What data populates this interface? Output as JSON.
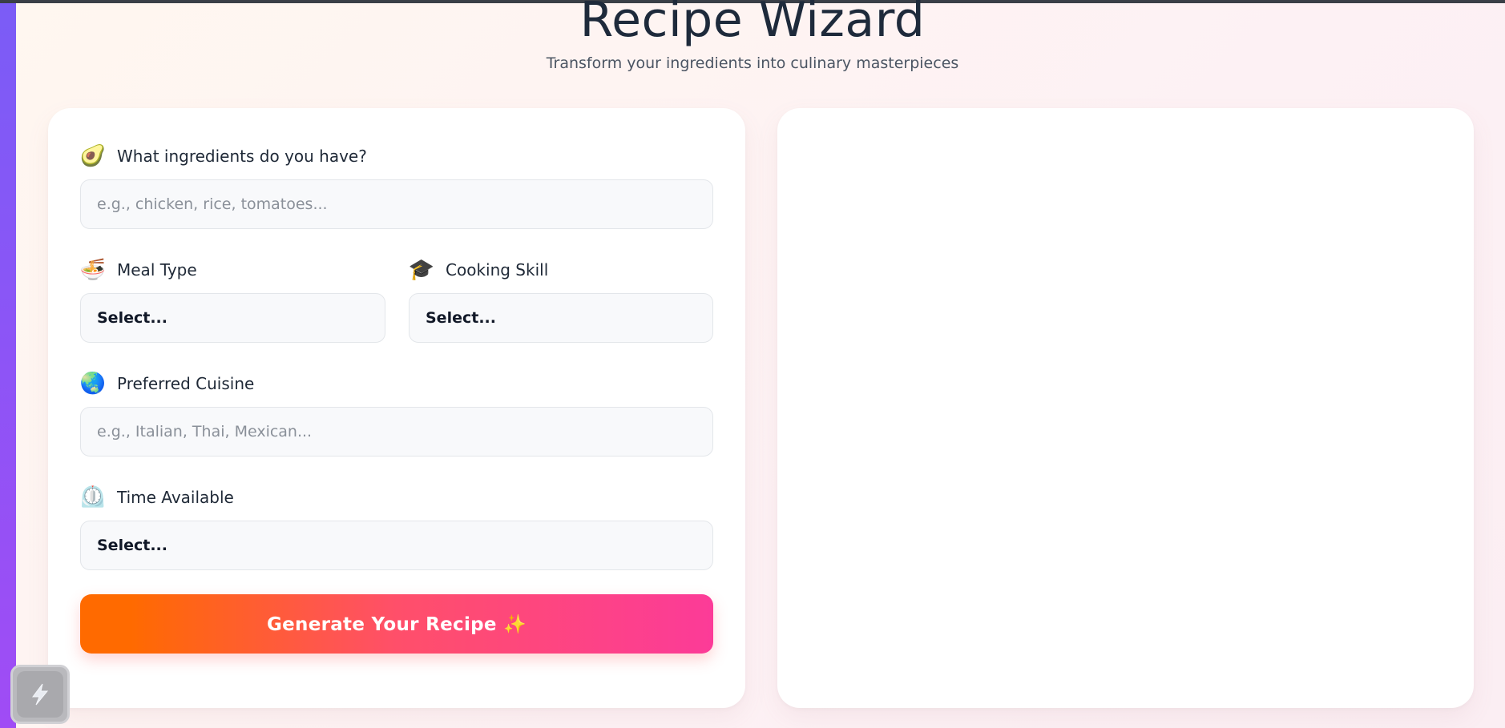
{
  "app": {
    "title": "Recipe Wizard",
    "subtitle": "Transform your ingredients into culinary masterpieces"
  },
  "form": {
    "ingredients": {
      "label": "What ingredients do you have?",
      "icon": "avocado-icon",
      "emoji": "🥑",
      "placeholder": "e.g., chicken, rice, tomatoes..."
    },
    "meal_type": {
      "label": "Meal Type",
      "icon": "noodle-bowl-icon",
      "emoji": "🍜",
      "value": "Select..."
    },
    "cooking_skill": {
      "label": "Cooking Skill",
      "icon": "graduation-cap-icon",
      "emoji": "🎓",
      "value": "Select..."
    },
    "cuisine": {
      "label": "Preferred Cuisine",
      "icon": "globe-icon",
      "emoji": "🌏",
      "placeholder": "e.g., Italian, Thai, Mexican..."
    },
    "time": {
      "label": "Time Available",
      "icon": "timer-clock-icon",
      "emoji": "⏲️",
      "value": "Select..."
    },
    "submit_label": "Generate Your Recipe ✨"
  },
  "colors": {
    "accent_start": "#ff6a00",
    "accent_end": "#fc3b98",
    "side_strip": "#8b5cf6",
    "title_color": "#1e2a3b"
  }
}
